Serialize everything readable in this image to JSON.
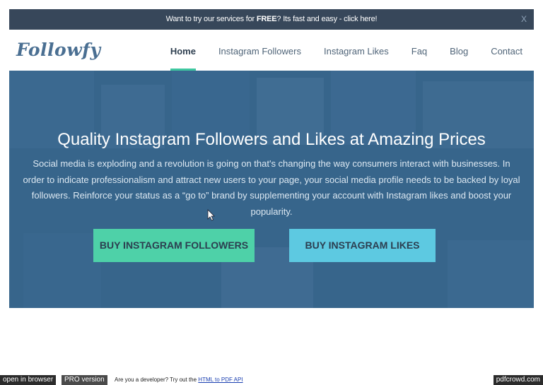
{
  "promo": {
    "text_before": "Want to try our services for ",
    "text_bold": "FREE",
    "text_after": "? Its fast and easy - click here!",
    "close_label": "X"
  },
  "header": {
    "logo": "Followfy",
    "nav": [
      {
        "label": "Home",
        "active": true
      },
      {
        "label": "Instagram Followers"
      },
      {
        "label": "Instagram Likes"
      },
      {
        "label": "Faq"
      },
      {
        "label": "Blog"
      },
      {
        "label": "Contact"
      }
    ]
  },
  "hero": {
    "title": "Quality Instagram Followers and Likes at Amazing Prices",
    "text": "Social media is exploding and a revolution is going on that's changing the way consumers interact with businesses. In order to indicate professionalism and attract new users to your page, your social media profile needs to be backed by loyal followers. Reinforce your status as a “go to” brand by supplementing your account with Instagram likes and boost your popularity.",
    "buttons": {
      "followers": "BUY INSTAGRAM FOLLOWERS",
      "likes": "BUY INSTAGRAM LIKES"
    }
  },
  "pdfbar": {
    "open": "open in browser",
    "pro": "PRO version",
    "dev_text": "Are you a developer? Try out the ",
    "dev_link": "HTML to PDF API",
    "brand": "pdfcrowd.com"
  },
  "colors": {
    "promo_bg": "#37475a",
    "accent": "#3fc8a0",
    "hero_overlay": "#34628a",
    "followers_button": "#4ed1a8",
    "likes_button": "#5dc9e1"
  }
}
